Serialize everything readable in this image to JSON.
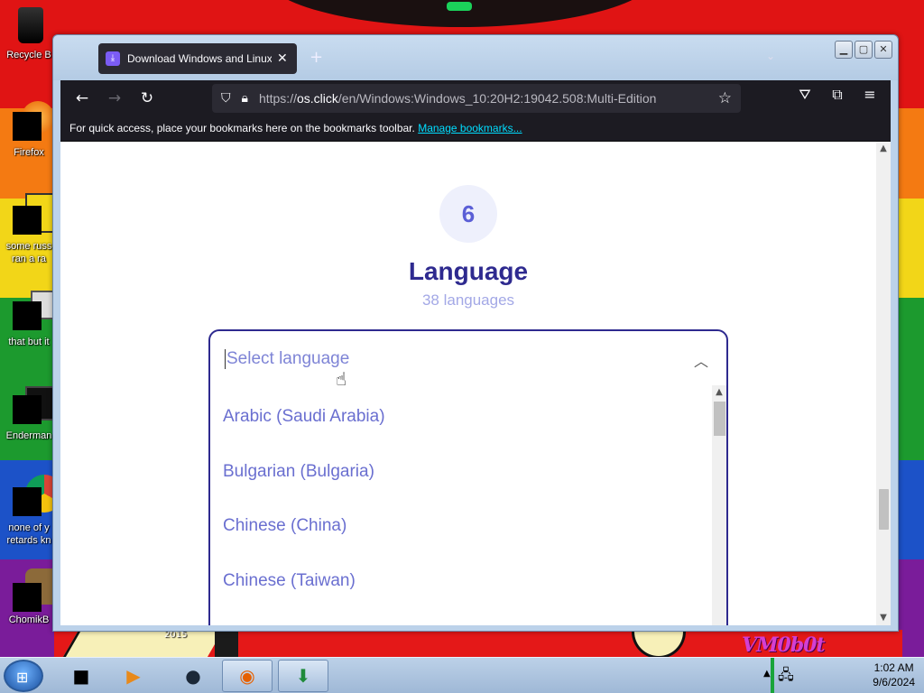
{
  "desktop": {
    "icons": [
      {
        "label": "Recycle B",
        "icon": "recycle-bin-icon"
      },
      {
        "label": "Firefox",
        "icon": "firefox-icon"
      },
      {
        "label": "some russ",
        "label2": "ran a ra",
        "icon": "file-icon"
      },
      {
        "label": "that but it",
        "icon": "folder-icon"
      },
      {
        "label": "Enderman",
        "icon": "terminal-icon"
      },
      {
        "label": "none of y",
        "label2": "retards kn",
        "icon": "chrome-icon"
      },
      {
        "label": "ChomikB",
        "icon": "hamster-icon"
      }
    ],
    "wallpaper_label_year": "2015",
    "wallpaper_tag": "VM0b0t"
  },
  "browser": {
    "tab_title": "Download Windows and Linux",
    "url_prefix": "https://",
    "url_domain": "os.click",
    "url_path": "/en/Windows:Windows_10:20H2:19042.508:Multi-Edition",
    "bookmarks_text": "For quick access, place your bookmarks here on the bookmarks toolbar.",
    "bookmarks_link": "Manage bookmarks..."
  },
  "page": {
    "step_number": "6",
    "title": "Language",
    "subtitle": "38 languages",
    "select_placeholder": "Select language",
    "options": [
      "Arabic (Saudi Arabia)",
      "Bulgarian (Bulgaria)",
      "Chinese (China)",
      "Chinese (Taiwan)"
    ]
  },
  "taskbar": {
    "time": "1:02 AM",
    "date": "9/6/2024"
  },
  "colors": {
    "accent": "#2e2a8f",
    "option_text": "#6a6fd0",
    "link": "#00ddff"
  }
}
